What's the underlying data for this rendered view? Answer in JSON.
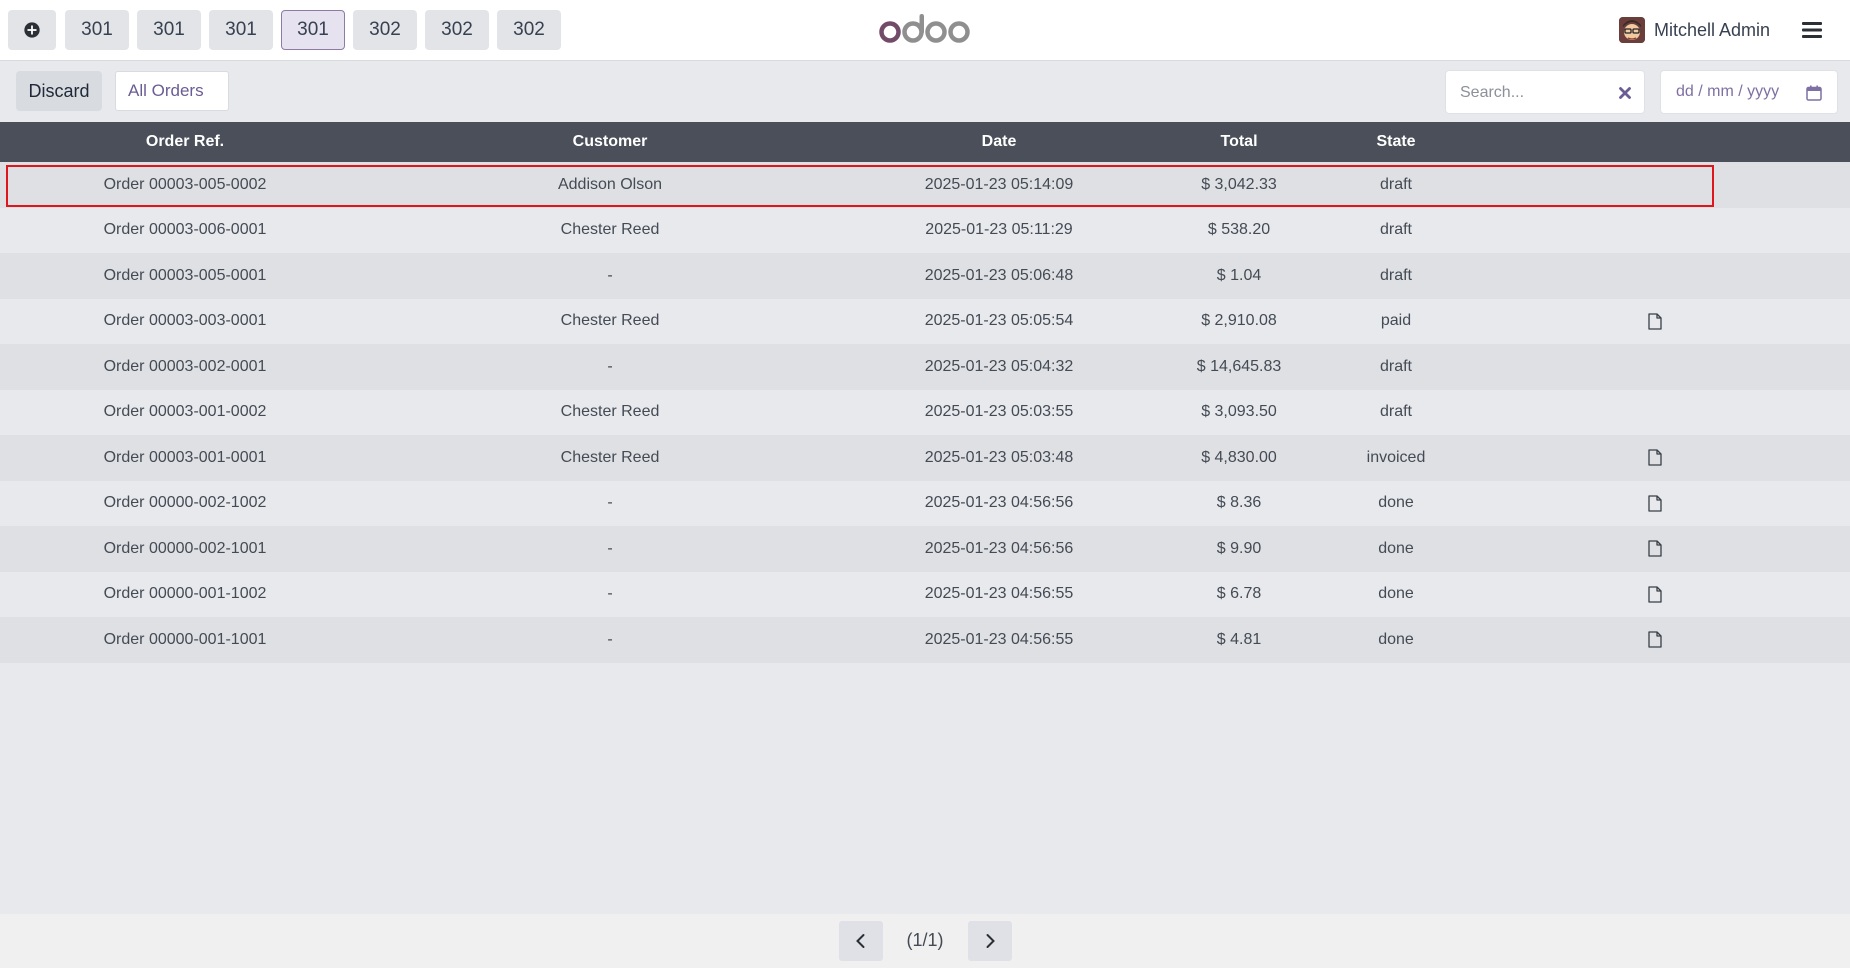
{
  "topbar": {
    "tabs": [
      {
        "label": "301",
        "active": false
      },
      {
        "label": "301",
        "active": false
      },
      {
        "label": "301",
        "active": false
      },
      {
        "label": "301",
        "active": true
      },
      {
        "label": "302",
        "active": false
      },
      {
        "label": "302",
        "active": false
      },
      {
        "label": "302",
        "active": false
      }
    ],
    "logo_text": "odoo",
    "user_name": "Mitchell Admin"
  },
  "controls": {
    "discard_label": "Discard",
    "filter_label": "All Orders",
    "search_placeholder": "Search...",
    "date_placeholder": "dd / mm / yyyy"
  },
  "table": {
    "headers": {
      "ref": "Order Ref.",
      "customer": "Customer",
      "date": "Date",
      "total": "Total",
      "state": "State"
    },
    "rows": [
      {
        "ref": "Order 00003-005-0002",
        "customer": "Addison Olson",
        "date": "2025-01-23 05:14:09",
        "total": "$ 3,042.33",
        "state": "draft",
        "receipt": false,
        "selected": true
      },
      {
        "ref": "Order 00003-006-0001",
        "customer": "Chester Reed",
        "date": "2025-01-23 05:11:29",
        "total": "$ 538.20",
        "state": "draft",
        "receipt": false
      },
      {
        "ref": "Order 00003-005-0001",
        "customer": "-",
        "date": "2025-01-23 05:06:48",
        "total": "$ 1.04",
        "state": "draft",
        "receipt": false
      },
      {
        "ref": "Order 00003-003-0001",
        "customer": "Chester Reed",
        "date": "2025-01-23 05:05:54",
        "total": "$ 2,910.08",
        "state": "paid",
        "receipt": true
      },
      {
        "ref": "Order 00003-002-0001",
        "customer": "-",
        "date": "2025-01-23 05:04:32",
        "total": "$ 14,645.83",
        "state": "draft",
        "receipt": false
      },
      {
        "ref": "Order 00003-001-0002",
        "customer": "Chester Reed",
        "date": "2025-01-23 05:03:55",
        "total": "$ 3,093.50",
        "state": "draft",
        "receipt": false
      },
      {
        "ref": "Order 00003-001-0001",
        "customer": "Chester Reed",
        "date": "2025-01-23 05:03:48",
        "total": "$ 4,830.00",
        "state": "invoiced",
        "receipt": true
      },
      {
        "ref": "Order 00000-002-1002",
        "customer": "-",
        "date": "2025-01-23 04:56:56",
        "total": "$ 8.36",
        "state": "done",
        "receipt": true
      },
      {
        "ref": "Order 00000-002-1001",
        "customer": "-",
        "date": "2025-01-23 04:56:56",
        "total": "$ 9.90",
        "state": "done",
        "receipt": true
      },
      {
        "ref": "Order 00000-001-1002",
        "customer": "-",
        "date": "2025-01-23 04:56:55",
        "total": "$ 6.78",
        "state": "done",
        "receipt": true
      },
      {
        "ref": "Order 00000-001-1001",
        "customer": "-",
        "date": "2025-01-23 04:56:55",
        "total": "$ 4.81",
        "state": "done",
        "receipt": true
      }
    ]
  },
  "pager": {
    "text": "(1/1)"
  },
  "icons": {
    "new_order": "plus-circle-icon",
    "menu": "hamburger-menu-icon",
    "clear": "close-icon",
    "calendar": "calendar-icon",
    "receipt": "document-icon",
    "prev": "chevron-left-icon",
    "next": "chevron-right-icon"
  },
  "colors": {
    "brand": "#714b67",
    "header_bg": "#4a4f59",
    "highlight": "#e0161e",
    "active_tab_border": "#8d7ba5"
  }
}
